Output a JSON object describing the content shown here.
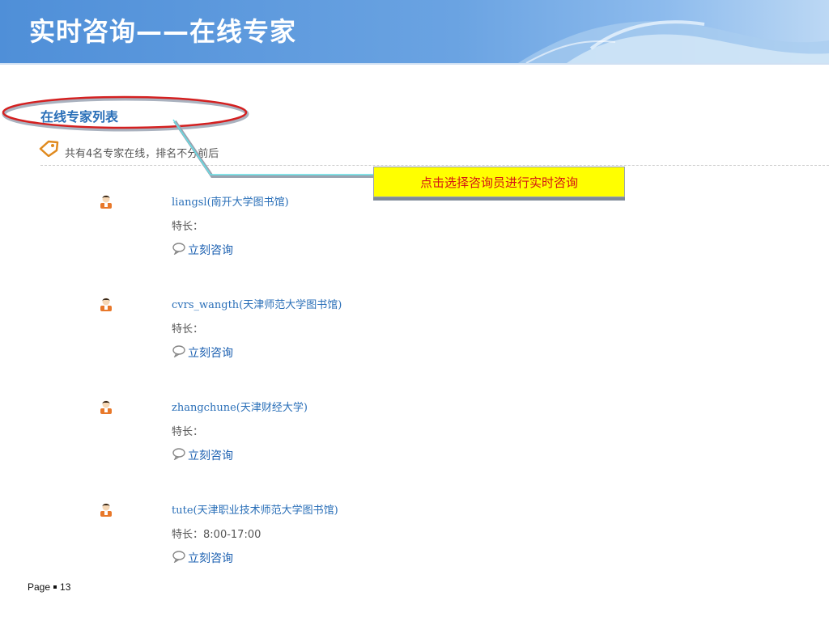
{
  "slide": {
    "title": "实时咨询——在线专家",
    "footer_label": "Page",
    "footer_number": "13"
  },
  "list": {
    "title": "在线专家列表",
    "count_text": "共有4名专家在线，排名不分前后",
    "consult_label": "立刻咨询",
    "specialty_label": "特长：",
    "experts": [
      {
        "name": "liangsl(南开大学图书馆)",
        "specialty": ""
      },
      {
        "name": "cvrs_wangth(天津师范大学图书馆)",
        "specialty": ""
      },
      {
        "name": "zhangchune(天津财经大学)",
        "specialty": ""
      },
      {
        "name": "tute(天津职业技术师范大学图书馆)",
        "specialty": "8:00-17:00"
      }
    ]
  },
  "callout": {
    "text": "点击选择咨询员进行实时咨询"
  },
  "colors": {
    "header": "#5b9be0",
    "link": "#2a6fb8",
    "callout_bg": "#ffff00",
    "callout_text": "#d41414",
    "highlight_ellipse": "#d42020"
  },
  "icons": {
    "tag": "tag-icon",
    "avatar": "user-avatar-icon",
    "chat": "speech-bubble-icon"
  }
}
